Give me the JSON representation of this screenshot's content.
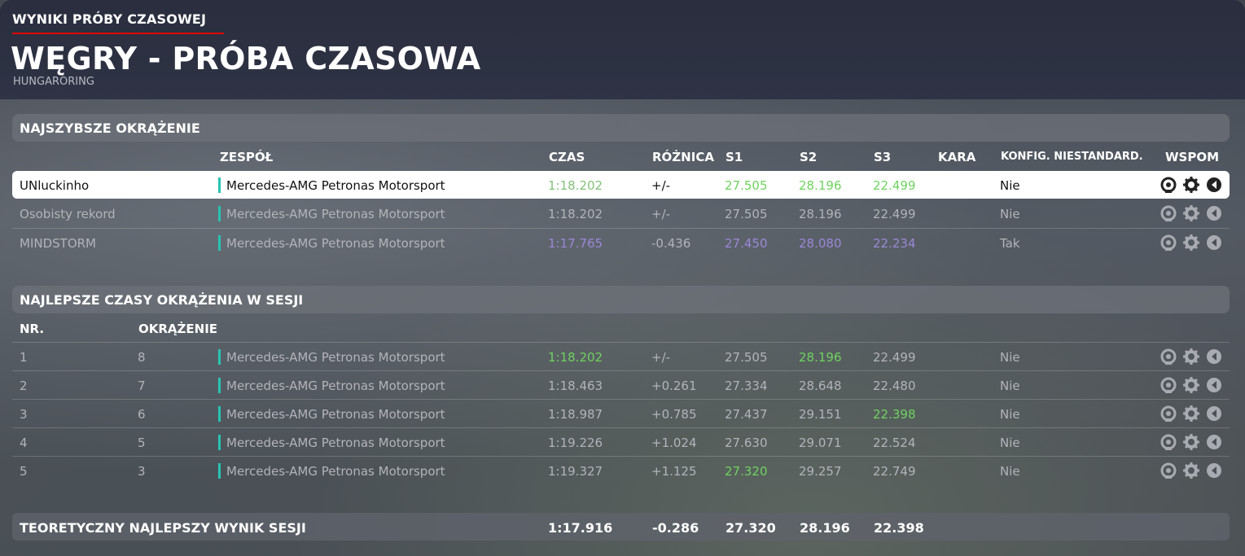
{
  "header": {
    "kicker": "WYNIKI PRÓBY CZASOWEJ",
    "title": "WĘGRY - PRÓBA CZASOWA",
    "track": "HUNGARORING"
  },
  "fastest": {
    "section_title": "NAJSZYBSZE OKRĄŻENIE",
    "columns": {
      "team": "ZESPÓŁ",
      "time": "CZAS",
      "diff": "RÓŻNICA",
      "s1": "S1",
      "s2": "S2",
      "s3": "S3",
      "penalty": "KARA",
      "config": "KONFIG. NIESTANDARD.",
      "replay": "WSPOM"
    },
    "rows": [
      {
        "name": "UNluckinho",
        "team": "Mercedes-AMG Petronas Motorsport",
        "time": "1:18.202",
        "diff": "+/-",
        "s1": "27.505",
        "s2": "28.196",
        "s3": "22.499",
        "penalty": "",
        "config": "Nie"
      },
      {
        "name": "Osobisty rekord",
        "team": "Mercedes-AMG Petronas Motorsport",
        "time": "1:18.202",
        "diff": "+/-",
        "s1": "27.505",
        "s2": "28.196",
        "s3": "22.499",
        "penalty": "",
        "config": "Nie"
      },
      {
        "name": "MINDSTORM",
        "team": "Mercedes-AMG Petronas Motorsport",
        "time": "1:17.765",
        "diff": "-0.436",
        "s1": "27.450",
        "s2": "28.080",
        "s3": "22.234",
        "penalty": "",
        "config": "Tak"
      }
    ]
  },
  "session": {
    "section_title": "NAJLEPSZE CZASY OKRĄŻENIA W SESJI",
    "columns": {
      "nr": "NR.",
      "lap": "OKRĄŻENIE"
    },
    "rows": [
      {
        "nr": "1",
        "lap": "8",
        "team": "Mercedes-AMG Petronas Motorsport",
        "time": "1:18.202",
        "diff": "+/-",
        "s1": "27.505",
        "s2": "28.196",
        "s3": "22.499",
        "config": "Nie"
      },
      {
        "nr": "2",
        "lap": "7",
        "team": "Mercedes-AMG Petronas Motorsport",
        "time": "1:18.463",
        "diff": "+0.261",
        "s1": "27.334",
        "s2": "28.648",
        "s3": "22.480",
        "config": "Nie"
      },
      {
        "nr": "3",
        "lap": "6",
        "team": "Mercedes-AMG Petronas Motorsport",
        "time": "1:18.987",
        "diff": "+0.785",
        "s1": "27.437",
        "s2": "29.151",
        "s3": "22.398",
        "config": "Nie"
      },
      {
        "nr": "4",
        "lap": "5",
        "team": "Mercedes-AMG Petronas Motorsport",
        "time": "1:19.226",
        "diff": "+1.024",
        "s1": "27.630",
        "s2": "29.071",
        "s3": "22.524",
        "config": "Nie"
      },
      {
        "nr": "5",
        "lap": "3",
        "team": "Mercedes-AMG Petronas Motorsport",
        "time": "1:19.327",
        "diff": "+1.125",
        "s1": "27.320",
        "s2": "29.257",
        "s3": "22.749",
        "config": "Nie"
      }
    ]
  },
  "theoretical": {
    "label": "TEORETYCZNY NAJLEPSZY WYNIK SESJI",
    "time": "1:17.916",
    "diff": "-0.286",
    "s1": "27.320",
    "s2": "28.196",
    "s3": "22.398"
  },
  "icons": [
    "replay-icon",
    "settings-gear-icon",
    "ghost-icon"
  ],
  "colors": {
    "accent_red": "#e10600",
    "team_stripe": "#27c4b3",
    "best_green": "#6fd35f",
    "record_purple": "#9b87d8"
  }
}
